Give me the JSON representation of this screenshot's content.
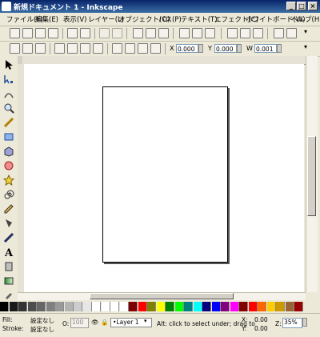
{
  "window": {
    "title": "新規ドキュメント 1 - Inkscape"
  },
  "menu": [
    "ファイル(F)",
    "編集(E)",
    "表示(V)",
    "レイヤー(L)",
    "オブジェクト(O)",
    "パス(P)",
    "テキスト(T)",
    "エフェクト(C)",
    "ホワイトボード(W)",
    "ヘルプ(H)"
  ],
  "controls": {
    "x_label": "X",
    "x_value": "0.000",
    "y_label": "Y",
    "y_value": "0.000",
    "w_label": "W",
    "w_value": "0.001"
  },
  "status": {
    "fill_label": "Fill:",
    "fill_value": "設定なし",
    "stroke_label": "Stroke:",
    "stroke_value": "設定なし",
    "opacity_label": "O:",
    "opacity_value": "100",
    "layer": "•Layer 1",
    "message": "Alt: click to select under; drag to",
    "x_label": "X:",
    "x_value": "0.00",
    "y_label": "Y:",
    "y_value": "0.00",
    "zoom_label": "Z:",
    "zoom_value": "35%"
  },
  "palette": [
    "#000000",
    "#1a1a1a",
    "#333333",
    "#4d4d4d",
    "#666666",
    "#808080",
    "#999999",
    "#b3b3b3",
    "#cccccc",
    "#e6e6e6",
    "#ffffff",
    "#ffffff",
    "#ffffff",
    "#ffffff",
    "#800000",
    "#ff0000",
    "#808000",
    "#ffff00",
    "#008000",
    "#00ff00",
    "#008080",
    "#00ffff",
    "#000080",
    "#0000ff",
    "#800080",
    "#ff00ff",
    "#800000",
    "#ff0000",
    "#ff6600",
    "#ffcc00",
    "#cc9900",
    "#996633",
    "#990000"
  ]
}
